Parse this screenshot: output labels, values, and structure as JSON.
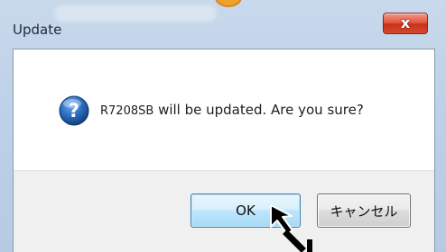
{
  "dialog": {
    "title": "Update",
    "close_label": "x",
    "message_model": "R7208SB",
    "message_text": " will be updated. Are you sure?",
    "icon": "question-icon"
  },
  "buttons": {
    "ok_label": "OK",
    "cancel_label": "キャンセル"
  },
  "colors": {
    "close_button": "#d3492f",
    "ok_button_border": "#3c7fb1",
    "question_icon": "#1f5fa8"
  }
}
